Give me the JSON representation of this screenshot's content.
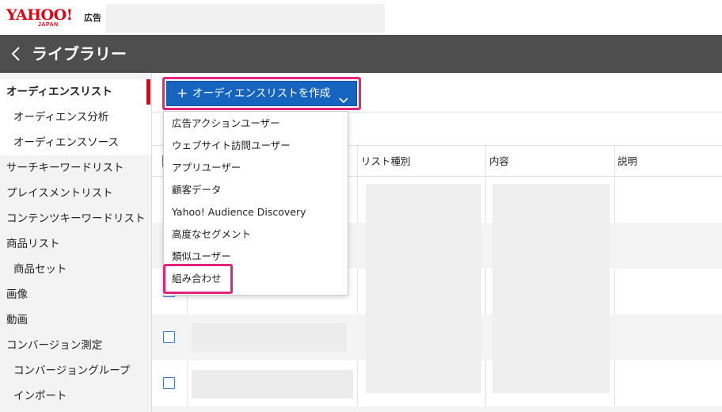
{
  "header": {
    "logo_main": "YAHOO!",
    "logo_sub": "JAPAN",
    "logo_ad": "広告"
  },
  "titlebar": {
    "title": "ライブラリー",
    "back_icon": "chevron-left-icon"
  },
  "sidebar": {
    "items": [
      {
        "label": "オーディエンスリスト",
        "level": 0,
        "active": true
      },
      {
        "label": "オーディエンス分析",
        "level": 1
      },
      {
        "label": "オーディエンスソース",
        "level": 1
      },
      {
        "label": "サーチキーワードリスト",
        "level": 0
      },
      {
        "label": "プレイスメントリスト",
        "level": 0
      },
      {
        "label": "コンテンツキーワードリスト",
        "level": 0
      },
      {
        "label": "商品リスト",
        "level": 0
      },
      {
        "label": "商品セット",
        "level": 1
      },
      {
        "label": "画像",
        "level": 0
      },
      {
        "label": "動画",
        "level": 0
      },
      {
        "label": "コンバージョン測定",
        "level": 0
      },
      {
        "label": "コンバージョングループ",
        "level": 1
      },
      {
        "label": "インポート",
        "level": 1
      }
    ]
  },
  "toolbar": {
    "create_button_label": "オーディエンスリストを作成",
    "create_button_icon": "plus-icon",
    "dropdown_icon": "chevron-down-icon"
  },
  "dropdown": {
    "items": [
      "広告アクションユーザー",
      "ウェブサイト訪問ユーザー",
      "アプリユーザー",
      "顧客データ",
      "Yahoo! Audience Discovery",
      "高度なセグメント",
      "類似ユーザー",
      "組み合わせ"
    ],
    "highlighted": "組み合わせ"
  },
  "table": {
    "columns": [
      "リスト種別",
      "内容",
      "説明"
    ]
  },
  "colors": {
    "brand_red": "#e60012",
    "highlight_pink": "#e6237c",
    "primary_blue": "#1565c0",
    "titlebar_gray": "#4e4e4e"
  }
}
